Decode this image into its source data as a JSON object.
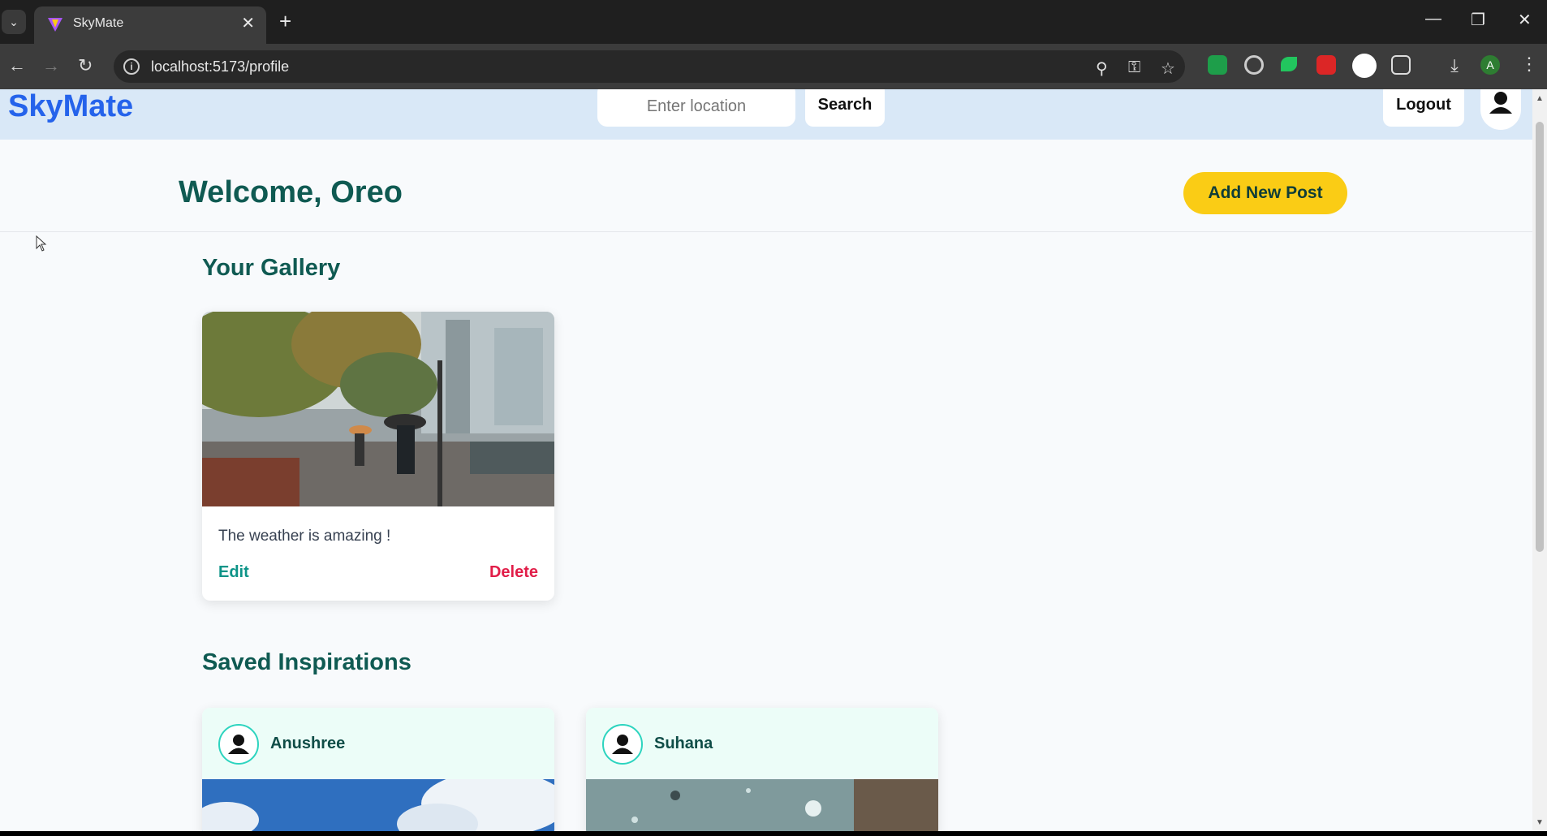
{
  "browser": {
    "tab_title": "SkyMate",
    "url": "localhost:5173/profile",
    "profile_initial": "A"
  },
  "header": {
    "logo": "SkyMate",
    "location_placeholder": "Enter location",
    "search_label": "Search",
    "logout_label": "Logout"
  },
  "welcome": {
    "title": "Welcome, Oreo",
    "add_post_label": "Add New Post"
  },
  "gallery": {
    "title": "Your Gallery",
    "posts": [
      {
        "caption": "The weather is amazing !",
        "edit_label": "Edit",
        "delete_label": "Delete"
      }
    ]
  },
  "inspirations": {
    "title": "Saved Inspirations",
    "items": [
      {
        "author": "Anushree"
      },
      {
        "author": "Suhana"
      }
    ]
  },
  "colors": {
    "brand": "#2563eb",
    "accent_yellow": "#facc15",
    "teal": "#0d9488",
    "danger": "#e11d48",
    "header_bg": "#d9e8f7"
  }
}
